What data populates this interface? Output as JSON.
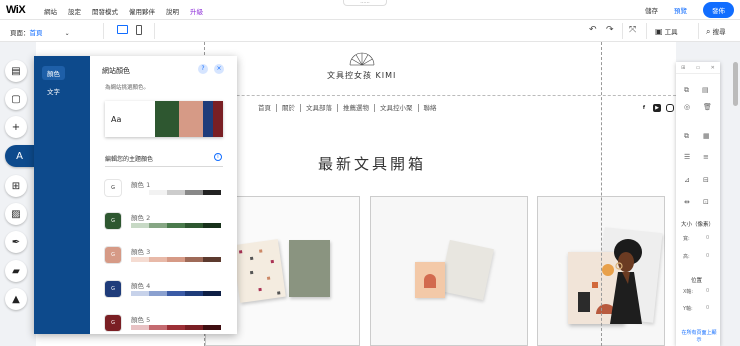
{
  "topbar": {
    "logo": "WiX",
    "menu": [
      "網站",
      "設定",
      "開發模式",
      "僱用夥伴",
      "說明",
      "升級"
    ],
    "save": "儲存",
    "preview": "預覽",
    "publish": "發佈",
    "tab": "......"
  },
  "subbar": {
    "page_label": "頁面：",
    "page_value": "首頁",
    "tools": "工具",
    "search": "搜尋",
    "icons": [
      "desktop-icon",
      "mobile-icon",
      "undo-icon",
      "redo-icon",
      "zoom-out-icon",
      "tools-icon",
      "search-icon"
    ]
  },
  "site": {
    "brand": "文具控女孩 KIMI",
    "nav": [
      "首頁",
      "關於",
      "文具部落",
      "推薦選物",
      "文具控小聚",
      "聯絡"
    ],
    "hero_title": "最新文具開箱"
  },
  "left_tools": [
    "pages-icon",
    "section-icon",
    "add-icon",
    "design-icon",
    "apps-icon",
    "media-icon",
    "pen-icon",
    "store-icon",
    "business-icon"
  ],
  "design_panel": {
    "tabs": [
      "顏色",
      "文字"
    ],
    "title": "網站顏色",
    "help": "?",
    "close": "×",
    "description": "為網站挑選顏色。",
    "palette_aa": "Aa",
    "palette_colors": [
      "#ffffff",
      "#2e5730",
      "#d69a86",
      "#1f3c7a",
      "#7a1f24"
    ],
    "edit_label": "編輯您的主題顏色",
    "info": "i",
    "colors": [
      {
        "label": "顏色 1",
        "chip": "#ffffff",
        "chip_text_color": "#333333",
        "strip": [
          "#ffffff",
          "#f2f2f2",
          "#cccccc",
          "#888888",
          "#222222"
        ]
      },
      {
        "label": "顏色 2",
        "chip": "#2e5730",
        "chip_text_color": "#ffffff",
        "strip": [
          "#c7d9c5",
          "#86a684",
          "#4a7a4c",
          "#2e5730",
          "#17301a"
        ]
      },
      {
        "label": "顏色 3",
        "chip": "#d69a86",
        "chip_text_color": "#ffffff",
        "strip": [
          "#f5dcd2",
          "#e8b9a8",
          "#d69a86",
          "#9e6a58",
          "#5c3a2e"
        ]
      },
      {
        "label": "顏色 4",
        "chip": "#1f3c7a",
        "chip_text_color": "#ffffff",
        "strip": [
          "#c7d2ea",
          "#8aa0cf",
          "#3b5ba6",
          "#1f3c7a",
          "#0e1f45"
        ]
      },
      {
        "label": "顏色 5",
        "chip": "#7a1f24",
        "chip_text_color": "#ffffff",
        "strip": [
          "#e8c2c4",
          "#c46a70",
          "#9c2f36",
          "#7a1f24",
          "#3f0e11"
        ]
      }
    ],
    "chip_glyph": "G"
  },
  "right_panel": {
    "size_label": "大小（像素）",
    "width_label": "寬:",
    "height_label": "高:",
    "width_value": "0",
    "height_value": "0",
    "position_label": "位置",
    "x_label": "X軸:",
    "y_label": "Y軸:",
    "x_value": "0",
    "y_value": "0",
    "footer": "在所有頁面上顯示"
  }
}
